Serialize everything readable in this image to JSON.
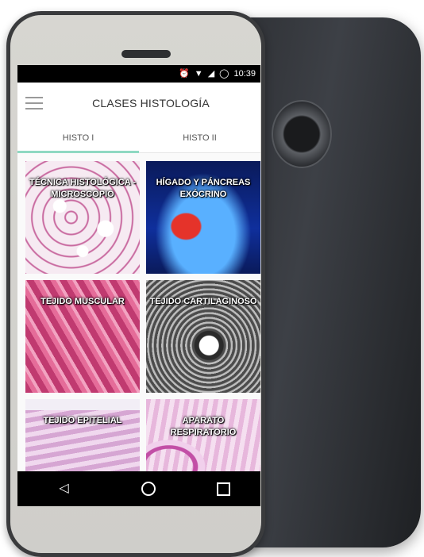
{
  "status_bar": {
    "time": "10:39",
    "icons": [
      "alarm-icon",
      "wifi-icon",
      "signal-icon",
      "battery-icon"
    ]
  },
  "app_bar": {
    "title": "CLASES HISTOLOGÍA",
    "menu_icon": "hamburger-icon"
  },
  "tabs": [
    {
      "label": "HISTO I",
      "active": true
    },
    {
      "label": "HISTO II",
      "active": false
    }
  ],
  "tiles": [
    {
      "label": "TÉCNICA HISTOLÓGICA - MICROSCOPIO"
    },
    {
      "label": "HÍGADO Y PÁNCREAS EXÓCRINO"
    },
    {
      "label": "TEJIDO MUSCULAR"
    },
    {
      "label": "TEJIDO CARTILAGINOSO"
    },
    {
      "label": "TEJIDO EPITELIAL"
    },
    {
      "label": "APARATO RESPIRATORIO"
    }
  ],
  "nav_bar": {
    "back_icon": "back-triangle-icon",
    "home_icon": "home-circle-icon",
    "recents_icon": "recents-square-icon"
  },
  "colors": {
    "tab_indicator": "#8fd9c2",
    "status_bar": "#000000",
    "nav_bar": "#000000"
  }
}
